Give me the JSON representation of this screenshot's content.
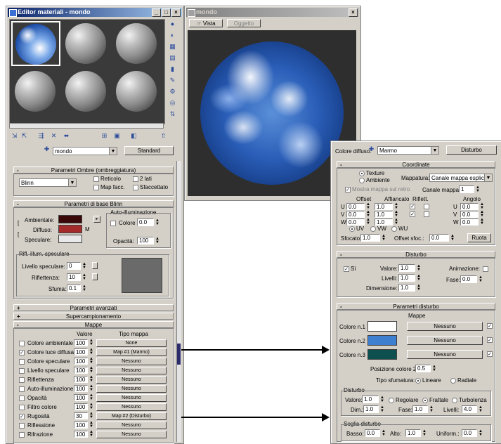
{
  "colors": {
    "diffuse": "#a52a2a",
    "ambient": "#3a0808",
    "specular": "#e8e8e8",
    "diffuse_dark": "#5a1010",
    "color1": "#ffffff",
    "color2": "#3f7fcf",
    "color3": "#0e5050"
  },
  "editor": {
    "title": "Editor materiali - mondo",
    "material_name": "mondo",
    "type_button": "Standard",
    "shader_rollout": "Parametri Ombre (ombreggiatura)",
    "shader_type": "Blinn",
    "shader_opts": [
      "Reticolo",
      "2 lati",
      "Map facc.",
      "Sfaccettato"
    ],
    "basic_rollout": "Parametri di base Blinn",
    "self_illum_group": "Auto-illuminazione",
    "ambient_label": "Ambientale:",
    "diffuse_label": "Diffuso:",
    "specular_label": "Speculare:",
    "color_label": "Colore",
    "color_value": "0.0",
    "opacity_label": "Opacità:",
    "opacity_value": "100",
    "highlights_group": "Rifl. illum. speculare",
    "spec_level_label": "Livello speculare:",
    "spec_level_value": "0",
    "glossiness_label": "Riflettenza:",
    "glossiness_value": "10",
    "soften_label": "Sfuma:",
    "soften_value": "0.1",
    "rollouts": [
      "Parametri avanzati",
      "Supercampionamento",
      "Mappe"
    ],
    "maps_header_amount": "Valore",
    "maps_header_type": "Tipo mappa",
    "maps": [
      {
        "name": "Colore ambientale",
        "checked": false,
        "amount": "100",
        "map": "None"
      },
      {
        "name": "Colore luce diffusa",
        "checked": true,
        "amount": "100",
        "map": "Map #1 (Marmo)"
      },
      {
        "name": "Colore speculare",
        "checked": false,
        "amount": "100",
        "map": "Nessuno"
      },
      {
        "name": "Livello speculare",
        "checked": false,
        "amount": "100",
        "map": "Nessuno"
      },
      {
        "name": "Riflettenza",
        "checked": false,
        "amount": "100",
        "map": "Nessuno"
      },
      {
        "name": "Auto-illuminazione",
        "checked": false,
        "amount": "100",
        "map": "Nessuno"
      },
      {
        "name": "Opacità",
        "checked": false,
        "amount": "100",
        "map": "Nessuno"
      },
      {
        "name": "Filtro colore",
        "checked": false,
        "amount": "100",
        "map": "Nessuno"
      },
      {
        "name": "Rugosità",
        "checked": true,
        "amount": "30",
        "map": "Map #2 (Disturbo)"
      },
      {
        "name": "Riflessione",
        "checked": false,
        "amount": "100",
        "map": "Nessuno"
      },
      {
        "name": "Rifrazione",
        "checked": false,
        "amount": "100",
        "map": "Nessuno"
      }
    ]
  },
  "viewer": {
    "title": "mondo",
    "tabs": [
      "Vista",
      "Oggetto"
    ]
  },
  "mapeditor": {
    "name_label": "Colore diffuso:",
    "map_name": "Marmo",
    "type_button": "Disturbo",
    "coords_rollout": "Coordinate",
    "texture_label": "Texture",
    "environ_label": "Ambiente",
    "mapping_label": "Mappatura:",
    "mapping_value": "Canale mappa esplicito",
    "show_map": "Mostra mappa sul retro",
    "map_channel_label": "Canale mappa:",
    "map_channel_value": "1",
    "offset_label": "Offset",
    "tiling_label": "Affiancato",
    "mirror_label": "Riflett.",
    "angle_label": "Angolo",
    "uvw_labels": [
      "U",
      "V",
      "W"
    ],
    "offset_values": [
      "0.0",
      "0.0",
      "0.0"
    ],
    "tiling_values": [
      "1.0",
      "1.0",
      "1.0"
    ],
    "angle_values": [
      "0.0",
      "0.0",
      "0.0"
    ],
    "uv_radios": [
      "UV",
      "VW",
      "WU"
    ],
    "blur_label": "Sfocato:",
    "blur_value": "1.0",
    "blur_offset_label": "Offset sfoc.:",
    "blur_offset_value": "0.0",
    "rotate_button": "Ruota",
    "noise_rollout": "Disturbo",
    "on_label": "Sì",
    "amount_label": "Valore:",
    "amount_value": "1.0",
    "levels_label": "Livelli:",
    "levels_value": "1.0",
    "size_label": "Dimensione:",
    "size_value": "1.0",
    "animate_label": "Animazione:",
    "phase_label": "Fase:",
    "phase_value": "0.0",
    "noise_params_rollout": "Parametri disturbo",
    "maps_col": "Mappe",
    "color_rows": [
      "Colore n.1",
      "Colore n.2",
      "Colore n.3"
    ],
    "color_btn": "Nessuno",
    "color2pos_label": "Posizione colore 2",
    "color2pos_value": "0.5",
    "grad_type_label": "Tipo sfumatura:",
    "grad_types": [
      "Lineare",
      "Radiale"
    ],
    "noise_group": "Disturbo",
    "noise_amount_label": "Valore:",
    "noise_amount_value": "1.0",
    "noise_types": [
      "Regolare",
      "Frattale",
      "Turbolenza"
    ],
    "noise_size_label": "Dim.:",
    "noise_size_value": "1.0",
    "noise_phase_label": "Fase:",
    "noise_phase_value": "1.0",
    "noise_levels_label": "Livelli:",
    "noise_levels_value": "4.0",
    "thresh_group": "Soglia disturbo",
    "low_label": "Basso:",
    "low_value": "0.0",
    "high_label": "Alto:",
    "high_value": "1.0",
    "smooth_label": "Uniform.:",
    "smooth_value": "0.0"
  }
}
